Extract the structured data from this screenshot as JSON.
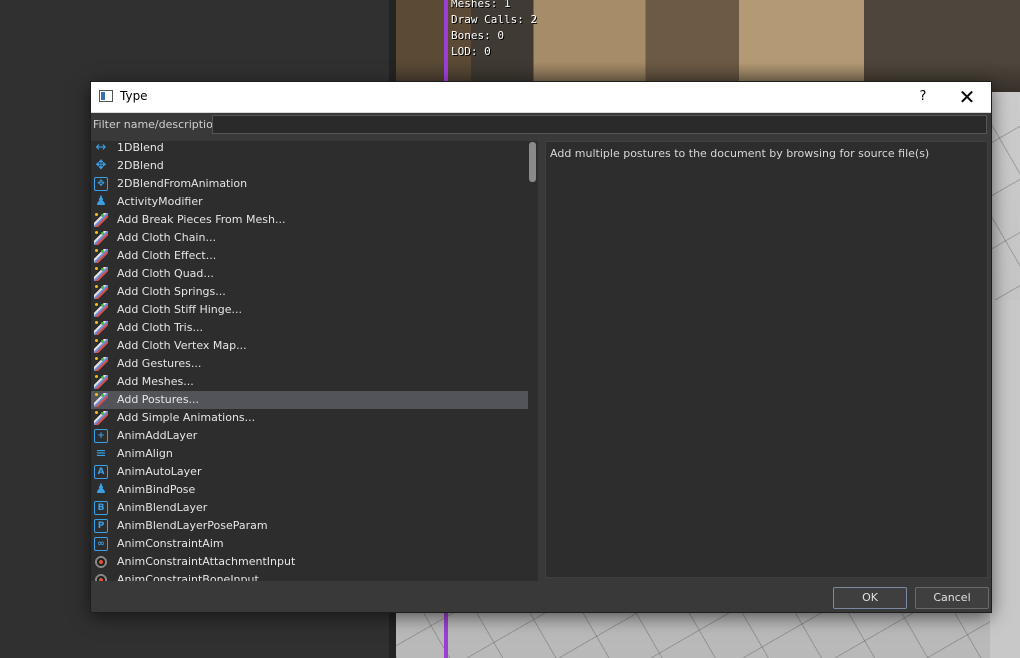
{
  "viewport": {
    "stats": [
      "Meshes: 1",
      "Draw Calls: 2",
      "Bones: 0",
      "LOD: 0"
    ]
  },
  "dialog": {
    "title": "Type",
    "help": "?",
    "close": "✕",
    "filter_label": "Filter name/description:",
    "filter_value": "",
    "description": "Add multiple postures to the document by browsing for source file(s)",
    "ok_label": "OK",
    "cancel_label": "Cancel",
    "items": [
      {
        "label": "1DBlend",
        "icon": "arrow-horizontal-icon"
      },
      {
        "label": "2DBlend",
        "icon": "arrows-cross-icon"
      },
      {
        "label": "2DBlendFromAnimation",
        "icon": "arrows-box-icon"
      },
      {
        "label": "ActivityModifier",
        "icon": "figure-icon"
      },
      {
        "label": "Add Break Pieces From Mesh...",
        "icon": "magic-wand-icon"
      },
      {
        "label": "Add Cloth Chain...",
        "icon": "magic-wand-icon"
      },
      {
        "label": "Add Cloth Effect...",
        "icon": "magic-wand-icon"
      },
      {
        "label": "Add Cloth Quad...",
        "icon": "magic-wand-icon"
      },
      {
        "label": "Add Cloth Springs...",
        "icon": "magic-wand-icon"
      },
      {
        "label": "Add Cloth Stiff Hinge...",
        "icon": "magic-wand-icon"
      },
      {
        "label": "Add Cloth Tris...",
        "icon": "magic-wand-icon"
      },
      {
        "label": "Add Cloth Vertex Map...",
        "icon": "magic-wand-icon"
      },
      {
        "label": "Add Gestures...",
        "icon": "magic-wand-icon"
      },
      {
        "label": "Add Meshes...",
        "icon": "magic-wand-icon"
      },
      {
        "label": "Add Postures...",
        "icon": "magic-wand-icon",
        "selected": true
      },
      {
        "label": "Add Simple Animations...",
        "icon": "magic-wand-icon"
      },
      {
        "label": "AnimAddLayer",
        "icon": "add-layer-icon"
      },
      {
        "label": "AnimAlign",
        "icon": "align-icon"
      },
      {
        "label": "AnimAutoLayer",
        "icon": "auto-layer-icon"
      },
      {
        "label": "AnimBindPose",
        "icon": "figure-icon"
      },
      {
        "label": "AnimBlendLayer",
        "icon": "blend-layer-icon"
      },
      {
        "label": "AnimBlendLayerPoseParam",
        "icon": "pose-param-icon"
      },
      {
        "label": "AnimConstraintAim",
        "icon": "link-icon"
      },
      {
        "label": "AnimConstraintAttachmentInput",
        "icon": "target-icon"
      },
      {
        "label": "AnimConstraintBoneInput",
        "icon": "target-icon"
      }
    ]
  }
}
